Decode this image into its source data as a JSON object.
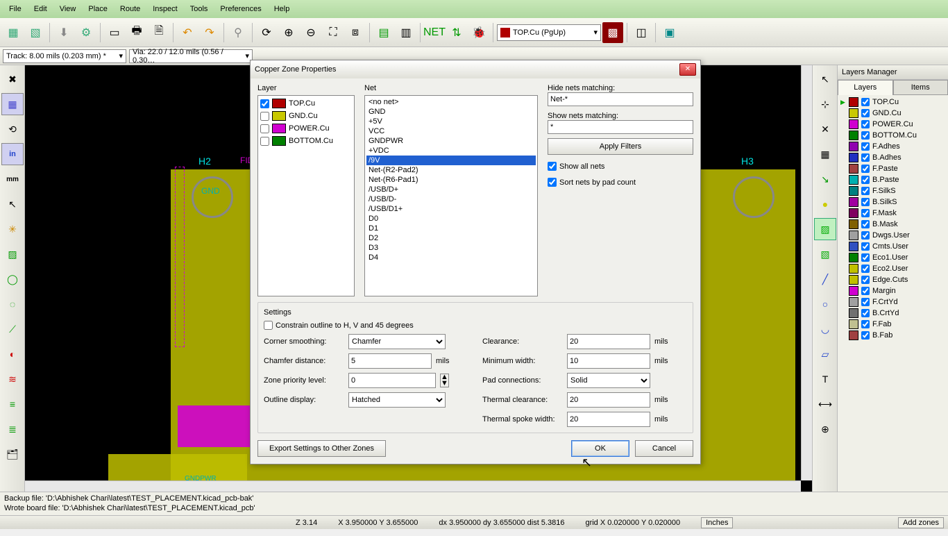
{
  "menu": [
    "File",
    "Edit",
    "View",
    "Place",
    "Route",
    "Inspect",
    "Tools",
    "Preferences",
    "Help"
  ],
  "layer_combo": "TOP.Cu (PgUp)",
  "track_combo": "Track: 8.00 mils (0.203 mm) *",
  "via_combo": "Via: 22.0 / 12.0 mils (0.56 / 0.30…",
  "layers_title": "Layers Manager",
  "tabs": {
    "layers": "Layers",
    "items": "Items"
  },
  "layers": [
    {
      "name": "TOP.Cu",
      "color": "#b00000",
      "checked": true,
      "current": true
    },
    {
      "name": "GND.Cu",
      "color": "#c8c800",
      "checked": true
    },
    {
      "name": "POWER.Cu",
      "color": "#d000d0",
      "checked": true
    },
    {
      "name": "BOTTOM.Cu",
      "color": "#008000",
      "checked": true
    },
    {
      "name": "F.Adhes",
      "color": "#9000b0",
      "checked": true
    },
    {
      "name": "B.Adhes",
      "color": "#2030c0",
      "checked": true
    },
    {
      "name": "F.Paste",
      "color": "#a04040",
      "checked": true
    },
    {
      "name": "B.Paste",
      "color": "#00b0b0",
      "checked": true
    },
    {
      "name": "F.SilkS",
      "color": "#008080",
      "checked": true
    },
    {
      "name": "B.SilkS",
      "color": "#a000a0",
      "checked": true
    },
    {
      "name": "F.Mask",
      "color": "#800060",
      "checked": true
    },
    {
      "name": "B.Mask",
      "color": "#806000",
      "checked": true
    },
    {
      "name": "Dwgs.User",
      "color": "#a0a0a0",
      "checked": true
    },
    {
      "name": "Cmts.User",
      "color": "#3050c0",
      "checked": true
    },
    {
      "name": "Eco1.User",
      "color": "#008000",
      "checked": true
    },
    {
      "name": "Eco2.User",
      "color": "#c0c000",
      "checked": true
    },
    {
      "name": "Edge.Cuts",
      "color": "#c0c000",
      "checked": true
    },
    {
      "name": "Margin",
      "color": "#d000d0",
      "checked": true
    },
    {
      "name": "F.CrtYd",
      "color": "#a0a0a0",
      "checked": true
    },
    {
      "name": "B.CrtYd",
      "color": "#707070",
      "checked": true
    },
    {
      "name": "F.Fab",
      "color": "#c0c090",
      "checked": true
    },
    {
      "name": "B.Fab",
      "color": "#a04040",
      "checked": true
    }
  ],
  "dialog": {
    "title": "Copper Zone Properties",
    "layer_label": "Layer",
    "net_label": "Net",
    "layers_list": [
      {
        "name": "TOP.Cu",
        "color": "#b00000",
        "checked": true
      },
      {
        "name": "GND.Cu",
        "color": "#c8c800",
        "checked": false
      },
      {
        "name": "POWER.Cu",
        "color": "#d000d0",
        "checked": false
      },
      {
        "name": "BOTTOM.Cu",
        "color": "#008000",
        "checked": false
      }
    ],
    "nets": [
      "<no net>",
      "GND",
      "+5V",
      "VCC",
      "GNDPWR",
      "+VDC",
      "/9V",
      "Net-(R2-Pad2)",
      "Net-(R6-Pad1)",
      "/USB/D+",
      "/USB/D-",
      "/USB/D1+",
      "D0",
      "D1",
      "D2",
      "D3",
      "D4"
    ],
    "selected_net": "/9V",
    "hide_label": "Hide nets matching:",
    "hide_value": "Net-*",
    "show_label": "Show nets matching:",
    "show_value": "*",
    "apply_filters": "Apply Filters",
    "show_all": "Show all nets",
    "sort_by_pad": "Sort nets by pad count",
    "settings_label": "Settings",
    "constrain": "Constrain outline to H, V and 45 degrees",
    "corner_smoothing_label": "Corner smoothing:",
    "corner_smoothing": "Chamfer",
    "chamfer_dist_label": "Chamfer distance:",
    "chamfer_dist": "5",
    "zone_priority_label": "Zone priority level:",
    "zone_priority": "0",
    "outline_display_label": "Outline display:",
    "outline_display": "Hatched",
    "clearance_label": "Clearance:",
    "clearance": "20",
    "min_width_label": "Minimum width:",
    "min_width": "10",
    "pad_conn_label": "Pad connections:",
    "pad_conn": "Solid",
    "thermal_clr_label": "Thermal clearance:",
    "thermal_clr": "20",
    "thermal_spoke_label": "Thermal spoke width:",
    "thermal_spoke": "20",
    "mils": "mils",
    "export_btn": "Export Settings to Other Zones",
    "ok": "OK",
    "cancel": "Cancel"
  },
  "status": {
    "line1": "Backup file: 'D:\\Abhishek Chari\\latest\\TEST_PLACEMENT.kicad_pcb-bak'",
    "line2": "Wrote board file: 'D:\\Abhishek Chari\\latest\\TEST_PLACEMENT.kicad_pcb'",
    "z": "Z 3.14",
    "xy": "X 3.950000  Y 3.655000",
    "dxy": "dx 3.950000  dy 3.655000  dist 5.3816",
    "grid": "grid X 0.020000  Y 0.020000",
    "units": "Inches",
    "add_zones": "Add zones"
  }
}
